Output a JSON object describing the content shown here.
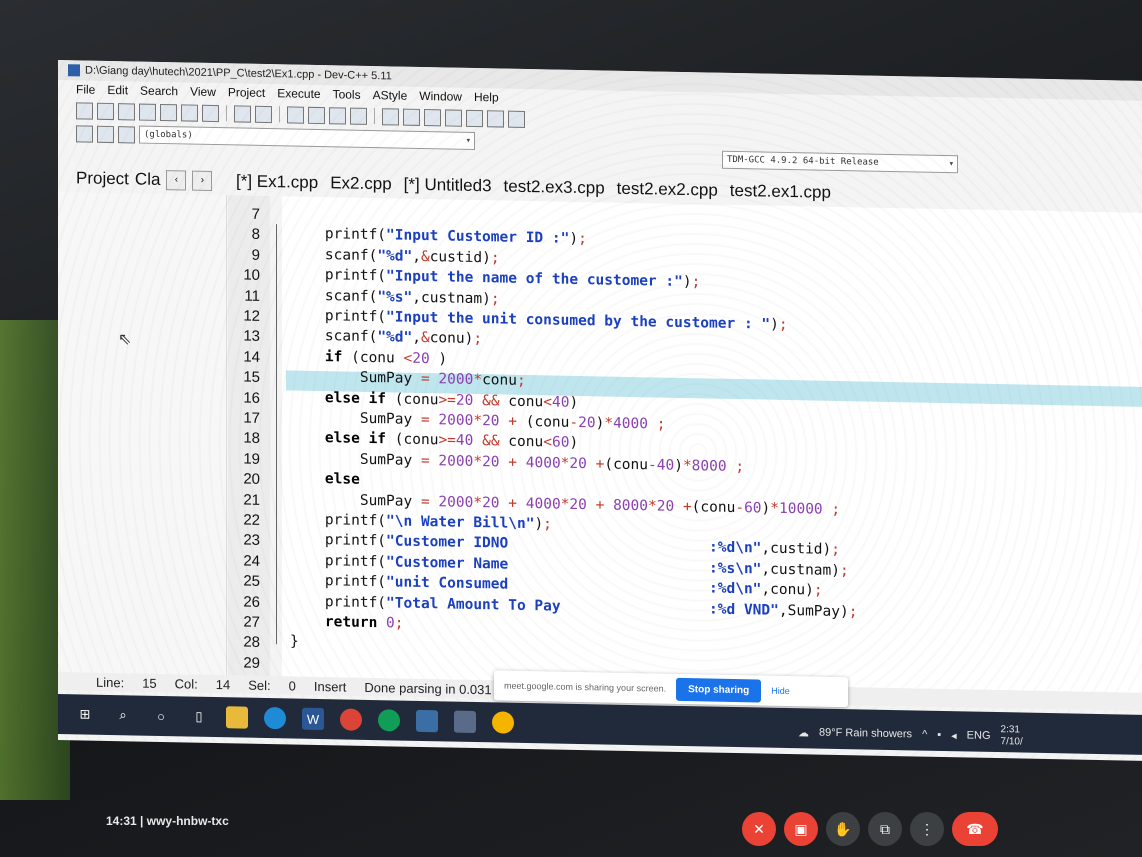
{
  "window": {
    "title": "D:\\Giang day\\hutech\\2021\\PP_C\\test2\\Ex1.cpp - Dev-C++ 5.11"
  },
  "menu": [
    "File",
    "Edit",
    "Search",
    "View",
    "Project",
    "Execute",
    "Tools",
    "AStyle",
    "Window",
    "Help"
  ],
  "toolbar": {
    "globals_combo": "(globals)",
    "compiler_combo": "TDM-GCC 4.9.2 64-bit Release"
  },
  "panel": {
    "project_tab": "Project",
    "classes_tab": "Cla"
  },
  "tabs": [
    "[*] Ex1.cpp",
    "Ex2.cpp",
    "[*] Untitled3",
    "test2.ex3.cpp",
    "test2.ex2.cpp",
    "test2.ex1.cpp"
  ],
  "editor": {
    "lines": [
      {
        "n": "7",
        "code": ""
      },
      {
        "n": "8",
        "code": "    printf(\"Input Customer ID :\");"
      },
      {
        "n": "9",
        "code": "    scanf(\"%d\",&custid);"
      },
      {
        "n": "10",
        "code": "    printf(\"Input the name of the customer :\");"
      },
      {
        "n": "11",
        "code": "    scanf(\"%s\",custnam);"
      },
      {
        "n": "12",
        "code": "    printf(\"Input the unit consumed by the customer : \");"
      },
      {
        "n": "13",
        "code": "    scanf(\"%d\",&conu);"
      },
      {
        "n": "14",
        "code": "    if (conu <20 )"
      },
      {
        "n": "15",
        "code": "        SumPay = 2000*conu;"
      },
      {
        "n": "16",
        "code": "    else if (conu>=20 && conu<40)"
      },
      {
        "n": "17",
        "code": "        SumPay = 2000*20 + (conu-20)*4000 ;"
      },
      {
        "n": "18",
        "code": "    else if (conu>=40 && conu<60)"
      },
      {
        "n": "19",
        "code": "        SumPay = 2000*20 + 4000*20 +(conu-40)*8000 ;"
      },
      {
        "n": "20",
        "code": "    else"
      },
      {
        "n": "21",
        "code": "        SumPay = 2000*20 + 4000*20 + 8000*20 +(conu-60)*10000 ;"
      },
      {
        "n": "22",
        "code": "    printf(\"\\n Water Bill\\n\");"
      },
      {
        "n": "23",
        "code": "    printf(\"Customer IDNO                       :%d\\n\",custid);"
      },
      {
        "n": "24",
        "code": "    printf(\"Customer Name                       :%s\\n\",custnam);"
      },
      {
        "n": "25",
        "code": "    printf(\"unit Consumed                       :%d\\n\",conu);"
      },
      {
        "n": "26",
        "code": "    printf(\"Total Amount To Pay                 :%d VND\",SumPay);"
      },
      {
        "n": "27",
        "code": "    return 0;"
      },
      {
        "n": "28",
        "code": "}"
      },
      {
        "n": "29",
        "code": ""
      }
    ]
  },
  "status": {
    "line_label": "Line:",
    "line_value": "15",
    "col_label": "Col:",
    "col_value": "14",
    "sel_label": "Sel:",
    "sel_value": "0",
    "insert": "Insert",
    "parsing": "Done parsing in 0.031 seconds"
  },
  "share_notice": {
    "text": "meet.google.com is sharing your screen.",
    "stop": "Stop sharing",
    "hide": "Hide"
  },
  "taskbar": {
    "weather": "89°F Rain showers",
    "lang": "ENG",
    "time": "2:31",
    "date": "7/10/"
  },
  "meet": {
    "time": "14:31",
    "code": "wwy-hnbw-txc"
  }
}
